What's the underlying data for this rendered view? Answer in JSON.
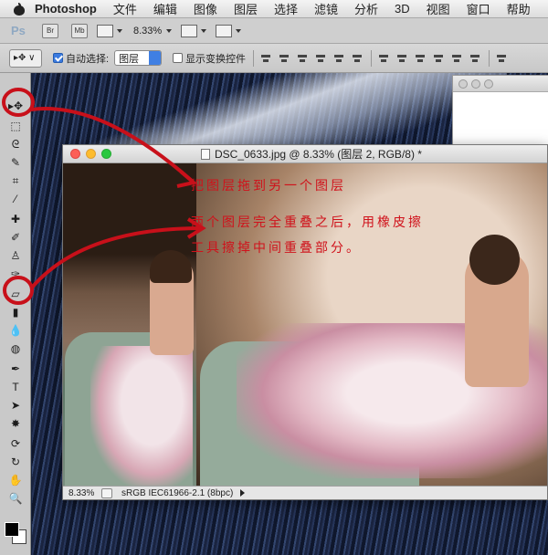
{
  "menubar": {
    "app_name": "Photoshop",
    "items": [
      "文件",
      "编辑",
      "图像",
      "图层",
      "选择",
      "滤镜",
      "分析",
      "3D",
      "视图",
      "窗口",
      "帮助"
    ]
  },
  "appbar": {
    "logo": "Ps",
    "bridge_label": "Br",
    "minibridge_label": "Mb",
    "zoom": "8.33%"
  },
  "options": {
    "tool_preset": "▸✥ ∨",
    "auto_select_label": "自动选择:",
    "auto_select_checked": true,
    "auto_select_value": "图层",
    "show_transform_label": "显示变换控件",
    "show_transform_checked": false
  },
  "document": {
    "title": "DSC_0633.jpg @ 8.33% (图层 2, RGB/8) *",
    "status_zoom": "8.33%",
    "status_profile": "sRGB IEC61966-2.1 (8bpc)"
  },
  "annotations": {
    "line1": "把图层拖到另一个图层",
    "line2": "两个图层完全重叠之后，用橡皮擦",
    "line3": "工具擦掉中间重叠部分。"
  },
  "colors": {
    "annotation_red": "#d0121b",
    "foreground": "#000000",
    "background": "#ffffff"
  }
}
